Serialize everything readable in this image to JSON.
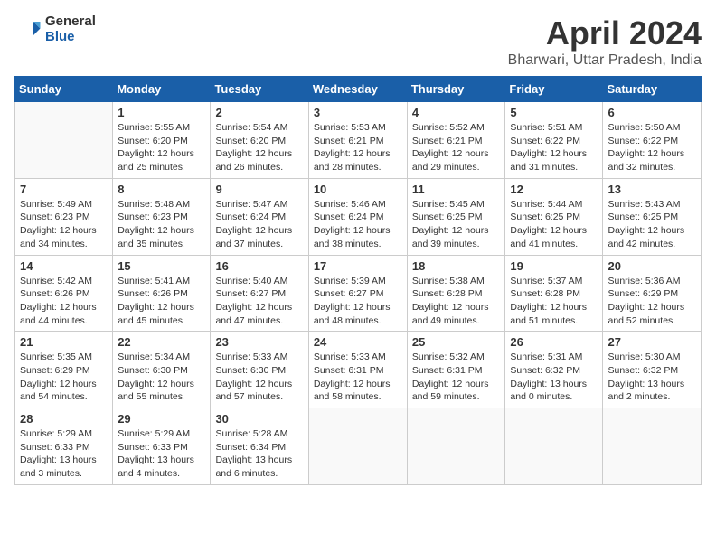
{
  "header": {
    "logo_general": "General",
    "logo_blue": "Blue",
    "title": "April 2024",
    "subtitle": "Bharwari, Uttar Pradesh, India"
  },
  "calendar": {
    "days_of_week": [
      "Sunday",
      "Monday",
      "Tuesday",
      "Wednesday",
      "Thursday",
      "Friday",
      "Saturday"
    ],
    "weeks": [
      [
        {
          "date": "",
          "info": ""
        },
        {
          "date": "1",
          "info": "Sunrise: 5:55 AM\nSunset: 6:20 PM\nDaylight: 12 hours\nand 25 minutes."
        },
        {
          "date": "2",
          "info": "Sunrise: 5:54 AM\nSunset: 6:20 PM\nDaylight: 12 hours\nand 26 minutes."
        },
        {
          "date": "3",
          "info": "Sunrise: 5:53 AM\nSunset: 6:21 PM\nDaylight: 12 hours\nand 28 minutes."
        },
        {
          "date": "4",
          "info": "Sunrise: 5:52 AM\nSunset: 6:21 PM\nDaylight: 12 hours\nand 29 minutes."
        },
        {
          "date": "5",
          "info": "Sunrise: 5:51 AM\nSunset: 6:22 PM\nDaylight: 12 hours\nand 31 minutes."
        },
        {
          "date": "6",
          "info": "Sunrise: 5:50 AM\nSunset: 6:22 PM\nDaylight: 12 hours\nand 32 minutes."
        }
      ],
      [
        {
          "date": "7",
          "info": "Sunrise: 5:49 AM\nSunset: 6:23 PM\nDaylight: 12 hours\nand 34 minutes."
        },
        {
          "date": "8",
          "info": "Sunrise: 5:48 AM\nSunset: 6:23 PM\nDaylight: 12 hours\nand 35 minutes."
        },
        {
          "date": "9",
          "info": "Sunrise: 5:47 AM\nSunset: 6:24 PM\nDaylight: 12 hours\nand 37 minutes."
        },
        {
          "date": "10",
          "info": "Sunrise: 5:46 AM\nSunset: 6:24 PM\nDaylight: 12 hours\nand 38 minutes."
        },
        {
          "date": "11",
          "info": "Sunrise: 5:45 AM\nSunset: 6:25 PM\nDaylight: 12 hours\nand 39 minutes."
        },
        {
          "date": "12",
          "info": "Sunrise: 5:44 AM\nSunset: 6:25 PM\nDaylight: 12 hours\nand 41 minutes."
        },
        {
          "date": "13",
          "info": "Sunrise: 5:43 AM\nSunset: 6:25 PM\nDaylight: 12 hours\nand 42 minutes."
        }
      ],
      [
        {
          "date": "14",
          "info": "Sunrise: 5:42 AM\nSunset: 6:26 PM\nDaylight: 12 hours\nand 44 minutes."
        },
        {
          "date": "15",
          "info": "Sunrise: 5:41 AM\nSunset: 6:26 PM\nDaylight: 12 hours\nand 45 minutes."
        },
        {
          "date": "16",
          "info": "Sunrise: 5:40 AM\nSunset: 6:27 PM\nDaylight: 12 hours\nand 47 minutes."
        },
        {
          "date": "17",
          "info": "Sunrise: 5:39 AM\nSunset: 6:27 PM\nDaylight: 12 hours\nand 48 minutes."
        },
        {
          "date": "18",
          "info": "Sunrise: 5:38 AM\nSunset: 6:28 PM\nDaylight: 12 hours\nand 49 minutes."
        },
        {
          "date": "19",
          "info": "Sunrise: 5:37 AM\nSunset: 6:28 PM\nDaylight: 12 hours\nand 51 minutes."
        },
        {
          "date": "20",
          "info": "Sunrise: 5:36 AM\nSunset: 6:29 PM\nDaylight: 12 hours\nand 52 minutes."
        }
      ],
      [
        {
          "date": "21",
          "info": "Sunrise: 5:35 AM\nSunset: 6:29 PM\nDaylight: 12 hours\nand 54 minutes."
        },
        {
          "date": "22",
          "info": "Sunrise: 5:34 AM\nSunset: 6:30 PM\nDaylight: 12 hours\nand 55 minutes."
        },
        {
          "date": "23",
          "info": "Sunrise: 5:33 AM\nSunset: 6:30 PM\nDaylight: 12 hours\nand 57 minutes."
        },
        {
          "date": "24",
          "info": "Sunrise: 5:33 AM\nSunset: 6:31 PM\nDaylight: 12 hours\nand 58 minutes."
        },
        {
          "date": "25",
          "info": "Sunrise: 5:32 AM\nSunset: 6:31 PM\nDaylight: 12 hours\nand 59 minutes."
        },
        {
          "date": "26",
          "info": "Sunrise: 5:31 AM\nSunset: 6:32 PM\nDaylight: 13 hours\nand 0 minutes."
        },
        {
          "date": "27",
          "info": "Sunrise: 5:30 AM\nSunset: 6:32 PM\nDaylight: 13 hours\nand 2 minutes."
        }
      ],
      [
        {
          "date": "28",
          "info": "Sunrise: 5:29 AM\nSunset: 6:33 PM\nDaylight: 13 hours\nand 3 minutes."
        },
        {
          "date": "29",
          "info": "Sunrise: 5:29 AM\nSunset: 6:33 PM\nDaylight: 13 hours\nand 4 minutes."
        },
        {
          "date": "30",
          "info": "Sunrise: 5:28 AM\nSunset: 6:34 PM\nDaylight: 13 hours\nand 6 minutes."
        },
        {
          "date": "",
          "info": ""
        },
        {
          "date": "",
          "info": ""
        },
        {
          "date": "",
          "info": ""
        },
        {
          "date": "",
          "info": ""
        }
      ]
    ]
  }
}
